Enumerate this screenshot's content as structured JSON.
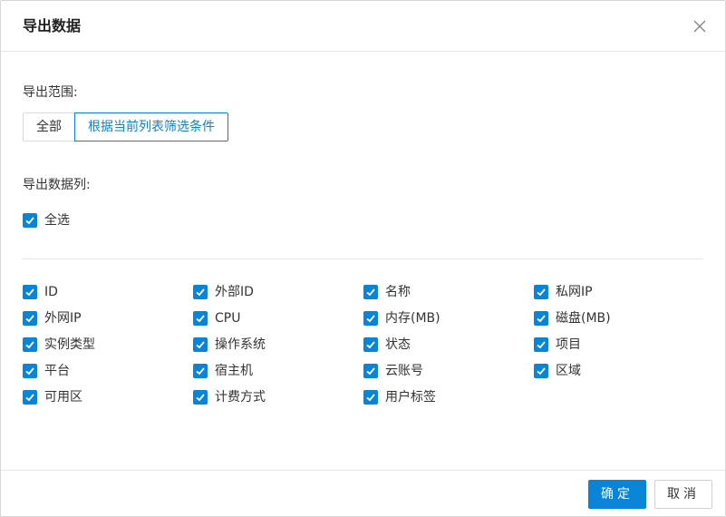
{
  "dialog": {
    "title": "导出数据",
    "close_icon": "close-icon"
  },
  "range": {
    "label": "导出范围:",
    "options": [
      {
        "label": "全部",
        "selected": false
      },
      {
        "label": "根据当前列表筛选条件",
        "selected": true
      }
    ]
  },
  "columns": {
    "label": "导出数据列:",
    "select_all": {
      "label": "全选",
      "checked": true
    },
    "items": [
      {
        "label": "ID",
        "checked": true
      },
      {
        "label": "外部ID",
        "checked": true
      },
      {
        "label": "名称",
        "checked": true
      },
      {
        "label": "私网IP",
        "checked": true
      },
      {
        "label": "外网IP",
        "checked": true
      },
      {
        "label": "CPU",
        "checked": true
      },
      {
        "label": "内存(MB)",
        "checked": true
      },
      {
        "label": "磁盘(MB)",
        "checked": true
      },
      {
        "label": "实例类型",
        "checked": true
      },
      {
        "label": "操作系统",
        "checked": true
      },
      {
        "label": "状态",
        "checked": true
      },
      {
        "label": "项目",
        "checked": true
      },
      {
        "label": "平台",
        "checked": true
      },
      {
        "label": "宿主机",
        "checked": true
      },
      {
        "label": "云账号",
        "checked": true
      },
      {
        "label": "区域",
        "checked": true
      },
      {
        "label": "可用区",
        "checked": true
      },
      {
        "label": "计费方式",
        "checked": true
      },
      {
        "label": "用户标签",
        "checked": true
      }
    ]
  },
  "footer": {
    "ok_label": "确定",
    "cancel_label": "取消"
  },
  "colors": {
    "accent": "#0a84d6",
    "border": "#d9d9d9",
    "text": "#333333"
  }
}
